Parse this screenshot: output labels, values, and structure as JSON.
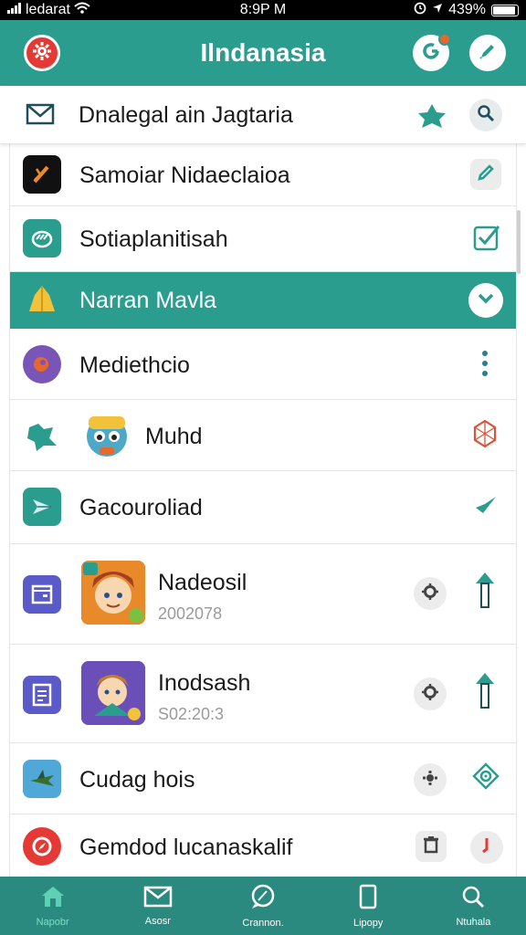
{
  "status_bar": {
    "carrier": "ledarat",
    "time": "8:9P M",
    "battery": "439%"
  },
  "app_bar": {
    "title": "Ilndanasia"
  },
  "search_row": {
    "label": "Dnalegal ain Jagtaria"
  },
  "rows": [
    {
      "label": "Samoiar Nidaeclaioa"
    },
    {
      "label": "Sotiaplanitisah"
    },
    {
      "label": "Narran Mavla"
    },
    {
      "label": "Mediethcio"
    },
    {
      "label": "Muhd"
    },
    {
      "label": "Gacouroliad"
    },
    {
      "label": "Nadeosil",
      "sub": "2002078"
    },
    {
      "label": "Inodsash",
      "sub": "S02:20:3"
    },
    {
      "label": "Cudag hois"
    },
    {
      "label": "Gemdod lucanaskalif"
    }
  ],
  "tab_bar": {
    "tabs": [
      {
        "label": "Napobr"
      },
      {
        "label": "Asosr"
      },
      {
        "label": "Crannon."
      },
      {
        "label": "Lipopy"
      },
      {
        "label": "Ntuhala"
      }
    ]
  },
  "colors": {
    "accent": "#2a9d8f",
    "tab_bar": "#2a8a7f",
    "danger": "#e53935"
  }
}
